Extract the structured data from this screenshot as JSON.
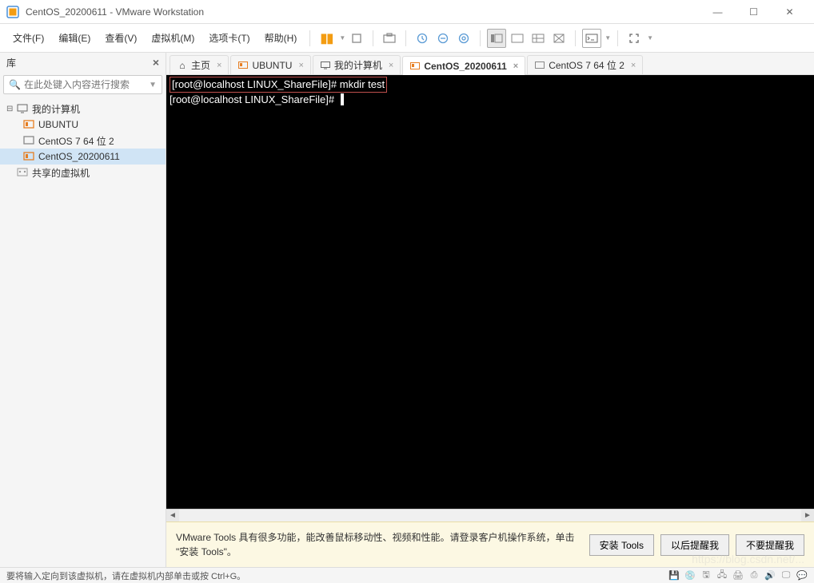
{
  "window": {
    "title": "CentOS_20200611 - VMware Workstation",
    "buttons": {
      "min": "—",
      "max": "☐",
      "close": "✕"
    }
  },
  "menu": {
    "items": [
      "文件(F)",
      "编辑(E)",
      "查看(V)",
      "虚拟机(M)",
      "选项卡(T)",
      "帮助(H)"
    ]
  },
  "sidebar": {
    "title": "库",
    "search_placeholder": "在此处键入内容进行搜索",
    "tree": {
      "root": "我的计算机",
      "vms": [
        "UBUNTU",
        "CentOS 7 64 位 2",
        "CentOS_20200611"
      ],
      "shared": "共享的虚拟机"
    }
  },
  "tabs": [
    {
      "label": "主页",
      "icon": "home"
    },
    {
      "label": "UBUNTU",
      "icon": "vm-running"
    },
    {
      "label": "我的计算机",
      "icon": "computer"
    },
    {
      "label": "CentOS_20200611",
      "icon": "vm-running",
      "active": true
    },
    {
      "label": "CentOS 7 64 位 2",
      "icon": "vm"
    }
  ],
  "terminal": {
    "line1_prompt": "[root@localhost LINUX_ShareFile]#",
    "line1_cmd": " mkdir test",
    "line2_prompt": "[root@localhost LINUX_ShareFile]#",
    "cursor": " "
  },
  "infobar": {
    "message": "VMware Tools 具有很多功能，能改善鼠标移动性、视频和性能。请登录客户机操作系统，单击 \"安装 Tools\"。",
    "btn_install": "安装 Tools",
    "btn_later": "以后提醒我",
    "btn_never": "不要提醒我"
  },
  "statusbar": {
    "text": "要将输入定向到该虚拟机，请在虚拟机内部单击或按 Ctrl+G。"
  },
  "watermark": "https://blog.csdn.net/..."
}
